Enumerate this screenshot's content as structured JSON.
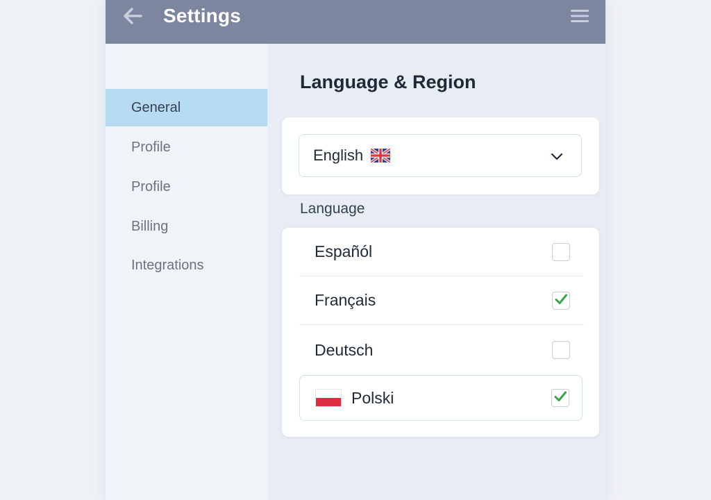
{
  "header": {
    "title": "Settings",
    "back_icon": "arrow-left-icon",
    "menu_icon": "hamburger-menu-icon",
    "background_color": "#7c879f"
  },
  "sidebar": {
    "items": [
      {
        "label": "General",
        "active": true
      },
      {
        "label": "Profile",
        "active": false
      },
      {
        "label": "Profile",
        "active": false
      },
      {
        "label": "Billing",
        "active": false
      },
      {
        "label": "Integrations",
        "active": false
      }
    ],
    "active_color": "#b7dcf2"
  },
  "main": {
    "section_title": "Language & Region",
    "language_select": {
      "value": "English",
      "flag_icon": "uk-flag-icon"
    },
    "list_label": "Language",
    "languages": [
      {
        "label": "Españól",
        "checked": false
      },
      {
        "label": "Français",
        "checked": true
      },
      {
        "label": "Deutsch",
        "checked": false
      },
      {
        "label": "Polski",
        "checked": true,
        "flag_icon": "poland-flag-icon"
      }
    ],
    "check_color": "#3aa345"
  }
}
